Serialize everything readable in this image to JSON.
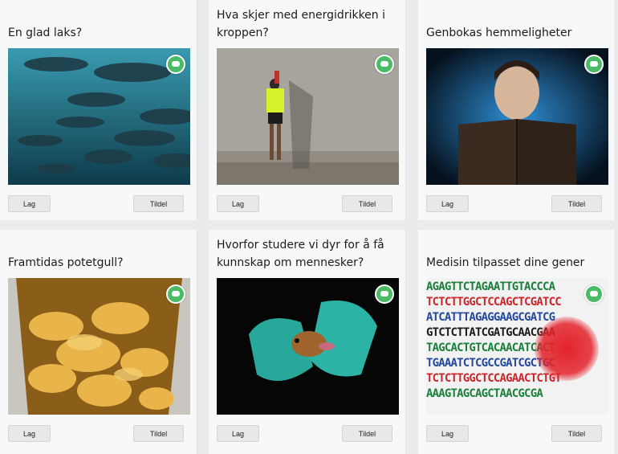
{
  "cards": [
    {
      "title": "En glad laks?",
      "button_lag": "Lag",
      "button_tildel": "Tildel",
      "image": "salmon-photo"
    },
    {
      "title": "Hva skjer med energidrikken i kroppen?",
      "button_lag": "Lag",
      "button_tildel": "Tildel",
      "image": "runner-drinking-photo"
    },
    {
      "title": "Genbokas hemmeligheter",
      "button_lag": "Lag",
      "button_tildel": "Tildel",
      "image": "man-reading-glowing-book-photo"
    },
    {
      "title": "Framtidas potetgull?",
      "button_lag": "Lag",
      "button_tildel": "Tildel",
      "image": "potato-chips-bag-photo"
    },
    {
      "title": "Hvorfor studere vi dyr for å få kunnskap om mennesker?",
      "button_lag": "Lag",
      "button_tildel": "Tildel",
      "image": "mouse-in-gloved-hands-photo"
    },
    {
      "title": "Medisin tilpasset dine gener",
      "button_lag": "Lag",
      "button_tildel": "Tildel",
      "image": "dna-sequence-photo"
    }
  ],
  "dna_lines": [
    "AGAGTTCTAGAATTGTACCCA",
    "TCTCTTGGCTCCAGCTCGATCC",
    "ATCATTTAGAGGAAGCGATCG",
    "GTCTCTTATCGATGCAACGAA",
    "TAGCACTGTCACAACATCACT",
    "TGAAATCTCGCCGATCGCTGC",
    "TCTCTTGGCTCCAGAACTCTGT",
    "AAAGTAGCAGCTAACGCGA"
  ],
  "colors": {
    "chat_badge": "#4cbb68",
    "card_bg": "#f7f8f9",
    "page_bg": "#e9ebed"
  }
}
